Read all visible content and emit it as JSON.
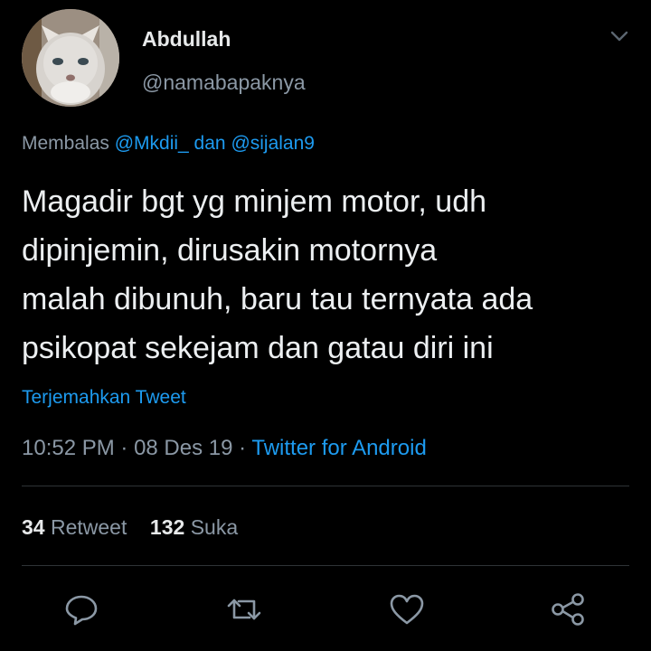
{
  "tweet": {
    "author_name": "Abdullah",
    "author_handle": "@namabapaknya",
    "reply_prefix": "Membalas ",
    "reply_to_1": "@Mkdii_",
    "reply_joiner": " dan ",
    "reply_to_2": "@sijalan9",
    "text_lines": [
      "Magadir bgt yg minjem motor, udh",
      "dipinjemin, dirusakin motornya",
      "malah dibunuh, baru tau ternyata ada",
      "psikopat sekejam dan gatau diri ini"
    ],
    "translate_label": "Terjemahkan Tweet",
    "time": "10:52 PM",
    "separator": " · ",
    "date": "08 Des 19",
    "client": "Twitter for Android"
  },
  "stats": {
    "retweet_count": "34",
    "retweet_label": "Retweet",
    "like_count": "132",
    "like_label": "Suka"
  },
  "icons": {
    "more": "chevron-down-icon",
    "reply": "comment-icon",
    "retweet": "retweet-icon",
    "like": "heart-icon",
    "share": "share-icon"
  },
  "colors": {
    "background": "#000000",
    "link": "#1d9bf0",
    "secondary_text": "#8b98a5",
    "primary_text": "#e7e9ea",
    "divider": "#2f3336"
  }
}
